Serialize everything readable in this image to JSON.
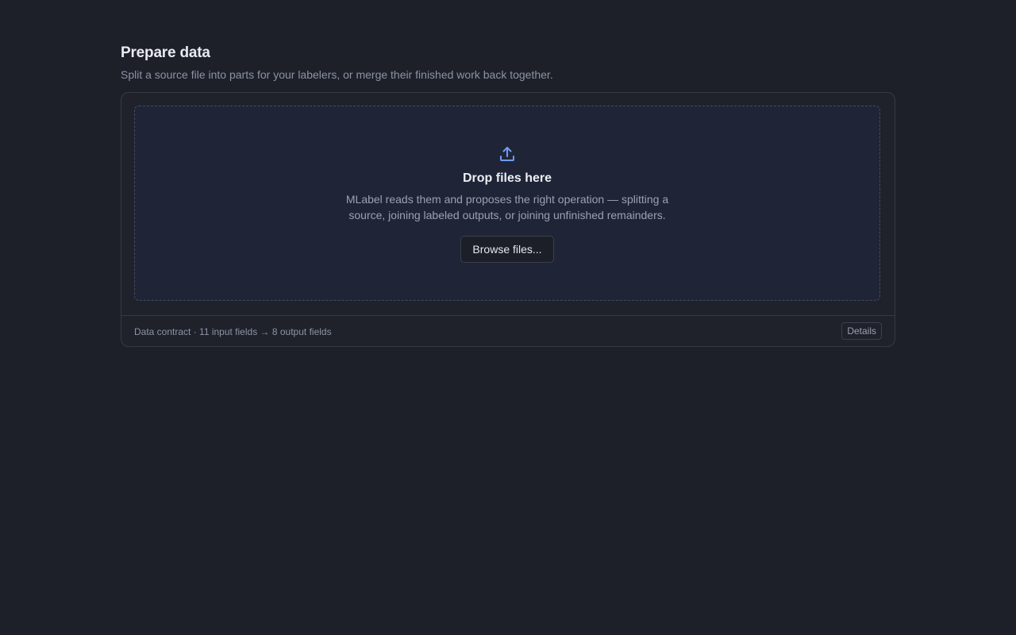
{
  "header": {
    "title": "Prepare data",
    "subtitle": "Split a source file into parts for your labelers, or merge their finished work back together."
  },
  "dropzone": {
    "icon": "upload-icon",
    "title": "Drop files here",
    "description": "MLabel reads them and proposes the right operation — splitting a source, joining labeled outputs, or joining unfinished remainders.",
    "browse_label": "Browse files..."
  },
  "footer": {
    "contract_text": "Data contract · 11 input fields → 8 output fields",
    "details_label": "Details"
  },
  "colors": {
    "background": "#1d2029",
    "accent": "#6f9cf7",
    "dropzone_bg": "#1f2537"
  }
}
